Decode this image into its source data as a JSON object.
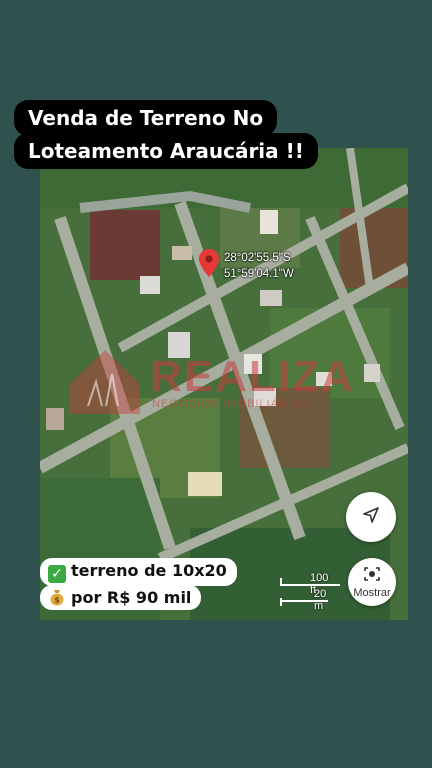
{
  "title": {
    "line1": "Venda de Terreno No",
    "line2": "Loteamento Araucária !!"
  },
  "map": {
    "coord_lat": "28°02'55.5\"S",
    "coord_lon": "51°59'04.1\"W",
    "watermark": "REALIZA",
    "watermark_sub": "NEGÓCIOS IMOBILIÁRIOS",
    "scale_ft": "100 ft",
    "scale_m": "20 m",
    "camera_label": "Mostrar",
    "icons": [
      "location-pin-icon",
      "navigation-arrow-icon",
      "lens-camera-icon",
      "check-mark-icon",
      "money-bag-icon"
    ]
  },
  "info": {
    "line1": "terreno de 10x20",
    "line2": "por R$ 90 mil"
  },
  "colors": {
    "background": "#2f524f",
    "pin": "#e53935",
    "check": "#3aa843"
  }
}
